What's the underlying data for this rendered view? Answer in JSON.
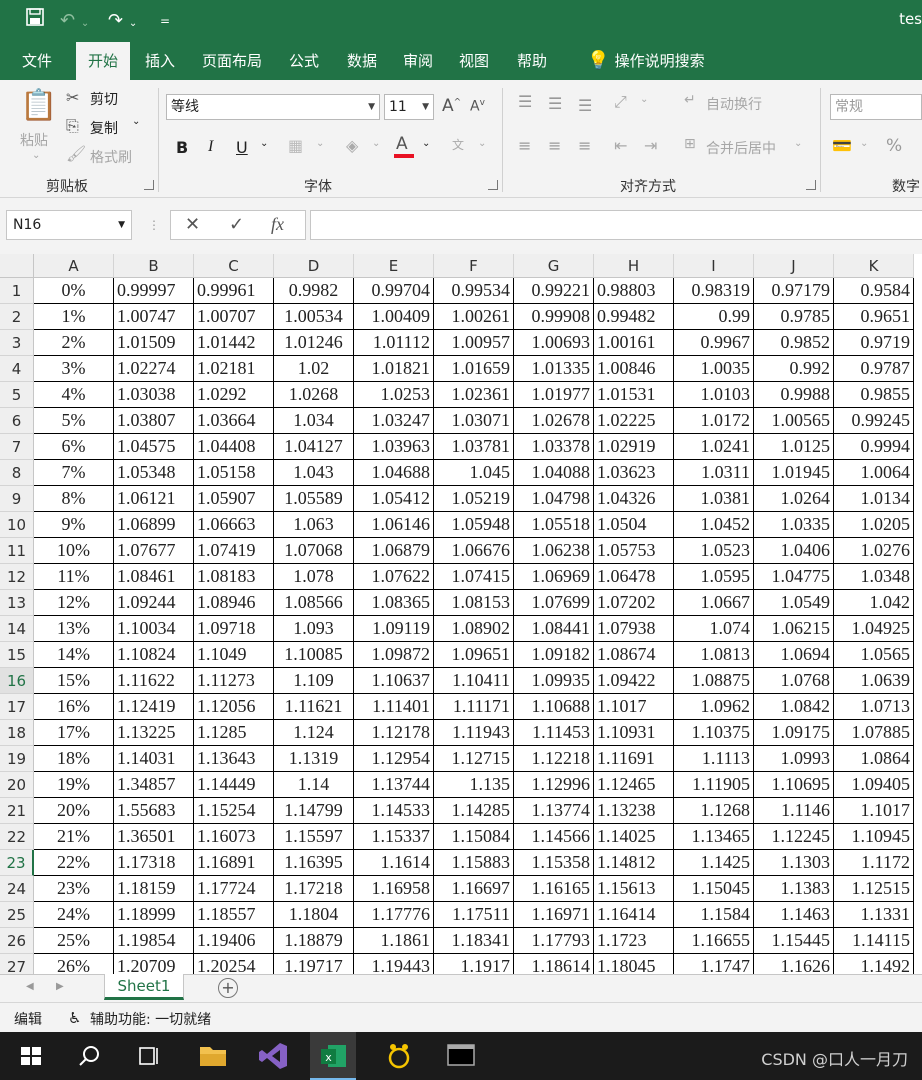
{
  "titlebar": {
    "title": "tes",
    "save_icon": "save-icon",
    "undo_icon": "undo-icon",
    "redo_icon": "redo-icon"
  },
  "menu": {
    "tabs": [
      "文件",
      "开始",
      "插入",
      "页面布局",
      "公式",
      "数据",
      "审阅",
      "视图",
      "帮助"
    ],
    "active": "开始",
    "tell_me": "操作说明搜索"
  },
  "ribbon": {
    "clipboard": {
      "paste": "粘贴",
      "cut": "剪切",
      "copy": "复制",
      "format_painter": "格式刷",
      "label": "剪贴板"
    },
    "font": {
      "name": "等线",
      "size": "11",
      "bold": "B",
      "italic": "I",
      "underline": "U",
      "label": "字体",
      "font_color": "#e81123"
    },
    "alignment": {
      "wrap": "自动换行",
      "merge": "合并后居中",
      "label": "对齐方式"
    },
    "number": {
      "format": "常规",
      "percent": "%",
      "label": "数字"
    }
  },
  "formula_bar": {
    "name_box": "N16",
    "cancel": "✕",
    "enter": "✓",
    "fx": "fx",
    "value": ""
  },
  "sheet": {
    "columns": [
      "A",
      "B",
      "C",
      "D",
      "E",
      "F",
      "G",
      "H",
      "I",
      "J",
      "K"
    ],
    "rows": [
      {
        "n": "1",
        "cells": [
          "0%",
          "0.99997",
          "0.99961",
          "0.9982",
          "0.99704",
          "0.99534",
          "0.99221",
          "0.98803",
          "0.98319",
          "0.97179",
          "0.9584"
        ]
      },
      {
        "n": "2",
        "cells": [
          "1%",
          "1.00747",
          "1.00707",
          "1.00534",
          "1.00409",
          "1.00261",
          "0.99908",
          "0.99482",
          "0.99",
          "0.9785",
          "0.9651"
        ]
      },
      {
        "n": "3",
        "cells": [
          "2%",
          "1.01509",
          "1.01442",
          "1.01246",
          "1.01112",
          "1.00957",
          "1.00693",
          "1.00161",
          "0.9967",
          "0.9852",
          "0.9719"
        ]
      },
      {
        "n": "4",
        "cells": [
          "3%",
          "1.02274",
          "1.02181",
          "1.02",
          "1.01821",
          "1.01659",
          "1.01335",
          "1.00846",
          "1.0035",
          "0.992",
          "0.9787"
        ]
      },
      {
        "n": "5",
        "cells": [
          "4%",
          "1.03038",
          "1.0292",
          "1.0268",
          "1.0253",
          "1.02361",
          "1.01977",
          "1.01531",
          "1.0103",
          "0.9988",
          "0.9855"
        ]
      },
      {
        "n": "6",
        "cells": [
          "5%",
          "1.03807",
          "1.03664",
          "1.034",
          "1.03247",
          "1.03071",
          "1.02678",
          "1.02225",
          "1.0172",
          "1.00565",
          "0.99245"
        ]
      },
      {
        "n": "7",
        "cells": [
          "6%",
          "1.04575",
          "1.04408",
          "1.04127",
          "1.03963",
          "1.03781",
          "1.03378",
          "1.02919",
          "1.0241",
          "1.0125",
          "0.9994"
        ]
      },
      {
        "n": "8",
        "cells": [
          "7%",
          "1.05348",
          "1.05158",
          "1.043",
          "1.04688",
          "1.045",
          "1.04088",
          "1.03623",
          "1.0311",
          "1.01945",
          "1.0064"
        ]
      },
      {
        "n": "9",
        "cells": [
          "8%",
          "1.06121",
          "1.05907",
          "1.05589",
          "1.05412",
          "1.05219",
          "1.04798",
          "1.04326",
          "1.0381",
          "1.0264",
          "1.0134"
        ]
      },
      {
        "n": "10",
        "cells": [
          "9%",
          "1.06899",
          "1.06663",
          "1.063",
          "1.06146",
          "1.05948",
          "1.05518",
          "1.0504",
          "1.0452",
          "1.0335",
          "1.0205"
        ]
      },
      {
        "n": "11",
        "cells": [
          "10%",
          "1.07677",
          "1.07419",
          "1.07068",
          "1.06879",
          "1.06676",
          "1.06238",
          "1.05753",
          "1.0523",
          "1.0406",
          "1.0276"
        ]
      },
      {
        "n": "12",
        "cells": [
          "11%",
          "1.08461",
          "1.08183",
          "1.078",
          "1.07622",
          "1.07415",
          "1.06969",
          "1.06478",
          "1.0595",
          "1.04775",
          "1.0348"
        ]
      },
      {
        "n": "13",
        "cells": [
          "12%",
          "1.09244",
          "1.08946",
          "1.08566",
          "1.08365",
          "1.08153",
          "1.07699",
          "1.07202",
          "1.0667",
          "1.0549",
          "1.042"
        ]
      },
      {
        "n": "14",
        "cells": [
          "13%",
          "1.10034",
          "1.09718",
          "1.093",
          "1.09119",
          "1.08902",
          "1.08441",
          "1.07938",
          "1.074",
          "1.06215",
          "1.04925"
        ]
      },
      {
        "n": "15",
        "cells": [
          "14%",
          "1.10824",
          "1.1049",
          "1.10085",
          "1.09872",
          "1.09651",
          "1.09182",
          "1.08674",
          "1.0813",
          "1.0694",
          "1.0565"
        ]
      },
      {
        "n": "16",
        "cells": [
          "15%",
          "1.11622",
          "1.11273",
          "1.109",
          "1.10637",
          "1.10411",
          "1.09935",
          "1.09422",
          "1.08875",
          "1.0768",
          "1.0639"
        ]
      },
      {
        "n": "17",
        "cells": [
          "16%",
          "1.12419",
          "1.12056",
          "1.11621",
          "1.11401",
          "1.11171",
          "1.10688",
          "1.1017",
          "1.0962",
          "1.0842",
          "1.0713"
        ]
      },
      {
        "n": "18",
        "cells": [
          "17%",
          "1.13225",
          "1.1285",
          "1.124",
          "1.12178",
          "1.11943",
          "1.11453",
          "1.10931",
          "1.10375",
          "1.09175",
          "1.07885"
        ]
      },
      {
        "n": "19",
        "cells": [
          "18%",
          "1.14031",
          "1.13643",
          "1.1319",
          "1.12954",
          "1.12715",
          "1.12218",
          "1.11691",
          "1.1113",
          "1.0993",
          "1.0864"
        ]
      },
      {
        "n": "20",
        "cells": [
          "19%",
          "1.34857",
          "1.14449",
          "1.14",
          "1.13744",
          "1.135",
          "1.12996",
          "1.12465",
          "1.11905",
          "1.10695",
          "1.09405"
        ]
      },
      {
        "n": "21",
        "cells": [
          "20%",
          "1.55683",
          "1.15254",
          "1.14799",
          "1.14533",
          "1.14285",
          "1.13774",
          "1.13238",
          "1.1268",
          "1.1146",
          "1.1017"
        ]
      },
      {
        "n": "22",
        "cells": [
          "21%",
          "1.36501",
          "1.16073",
          "1.15597",
          "1.15337",
          "1.15084",
          "1.14566",
          "1.14025",
          "1.13465",
          "1.12245",
          "1.10945"
        ]
      },
      {
        "n": "23",
        "cells": [
          "22%",
          "1.17318",
          "1.16891",
          "1.16395",
          "1.1614",
          "1.15883",
          "1.15358",
          "1.14812",
          "1.1425",
          "1.1303",
          "1.1172"
        ]
      },
      {
        "n": "24",
        "cells": [
          "23%",
          "1.18159",
          "1.17724",
          "1.17218",
          "1.16958",
          "1.16697",
          "1.16165",
          "1.15613",
          "1.15045",
          "1.1383",
          "1.12515"
        ]
      },
      {
        "n": "25",
        "cells": [
          "24%",
          "1.18999",
          "1.18557",
          "1.1804",
          "1.17776",
          "1.17511",
          "1.16971",
          "1.16414",
          "1.1584",
          "1.1463",
          "1.1331"
        ]
      },
      {
        "n": "26",
        "cells": [
          "25%",
          "1.19854",
          "1.19406",
          "1.18879",
          "1.1861",
          "1.18341",
          "1.17793",
          "1.1723",
          "1.16655",
          "1.15445",
          "1.14115"
        ]
      },
      {
        "n": "27",
        "cells": [
          "26%",
          "1.20709",
          "1.20254",
          "1.19717",
          "1.19443",
          "1.1917",
          "1.18614",
          "1.18045",
          "1.1747",
          "1.1626",
          "1.1492"
        ]
      }
    ],
    "selected_row": "16",
    "active_row": "23",
    "tab_name": "Sheet1"
  },
  "status": {
    "mode": "编辑",
    "accessibility": "辅助功能: 一切就绪"
  },
  "taskbar": {
    "watermark": "CSDN @口人一月刀"
  }
}
